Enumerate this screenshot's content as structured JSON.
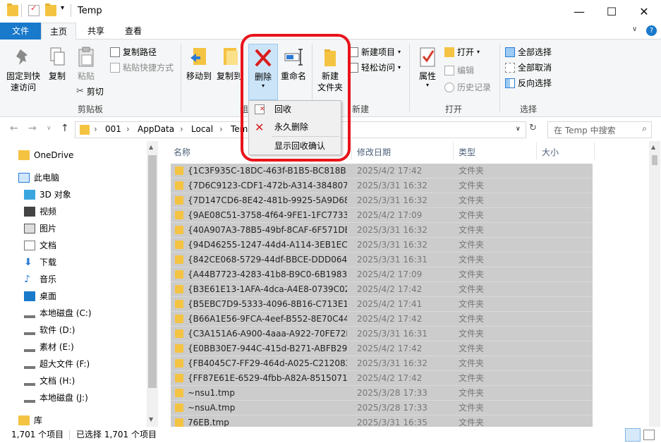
{
  "window": {
    "title": "Temp",
    "minimize_glyph": "—",
    "maximize_glyph": "☐",
    "close_glyph": "✕"
  },
  "tabs": {
    "file": "文件",
    "home": "主页",
    "share": "共享",
    "view": "查看"
  },
  "ribbon": {
    "pin": "固定到快\n速访问",
    "pin_l1": "固定到快",
    "pin_l2": "速访问",
    "copy": "复制",
    "paste": "粘贴",
    "copy_path": "复制路径",
    "paste_shortcut": "粘贴快捷方式",
    "cut": "剪切",
    "group_clipboard": "剪贴板",
    "move_to": "移动到",
    "copy_to": "复制到",
    "delete": "删除",
    "rename": "重命名",
    "group_organize": "组织",
    "new_folder_l1": "新建",
    "new_folder_l2": "文件夹",
    "new_item": "新建项目",
    "easy_access": "轻松访问",
    "group_new": "新建",
    "properties": "属性",
    "open": "打开",
    "edit": "编辑",
    "history": "历史记录",
    "group_open": "打开",
    "select_all": "全部选择",
    "select_none": "全部取消",
    "invert_selection": "反向选择",
    "group_select": "选择"
  },
  "delete_menu": {
    "recycle": "回收",
    "permanent": "永久删除",
    "show_confirm": "显示回收确认"
  },
  "address": {
    "crumbs": [
      "001",
      "AppData",
      "Local",
      "Temp"
    ],
    "search_placeholder": "在 Temp 中搜索"
  },
  "nav": {
    "onedrive": "OneDrive",
    "this_pc": "此电脑",
    "items": [
      "3D 对象",
      "视频",
      "图片",
      "文档",
      "下载",
      "音乐",
      "桌面",
      "本地磁盘 (C:)",
      "软件 (D:)",
      "素材 (E:)",
      "超大文件 (F:)",
      "文档 (H:)",
      "本地磁盘 (J:)"
    ],
    "library": "库"
  },
  "columns": {
    "name": "名称",
    "date": "修改日期",
    "type": "类型",
    "size": "大小"
  },
  "files": [
    {
      "name": "{1C3F935C-18DC-463f-B1B5-BC818B...",
      "date": "2025/4/2 17:42",
      "type": "文件夹"
    },
    {
      "name": "{7D6C9123-CDF1-472b-A314-384807...",
      "date": "2025/3/31 16:32",
      "type": "文件夹"
    },
    {
      "name": "{7D147CD6-8E42-481b-9925-5A9D68...",
      "date": "2025/3/31 16:32",
      "type": "文件夹"
    },
    {
      "name": "{9AE08C51-3758-4f64-9FE1-1FC7733...",
      "date": "2025/4/2 17:09",
      "type": "文件夹"
    },
    {
      "name": "{40A907A3-78B5-49bf-8CAF-6F571DB...",
      "date": "2025/3/31 16:32",
      "type": "文件夹"
    },
    {
      "name": "{94D46255-1247-44d4-A114-3EB1EC...",
      "date": "2025/3/31 16:32",
      "type": "文件夹"
    },
    {
      "name": "{842CE068-5729-44df-BBCE-DDD064...",
      "date": "2025/3/31 16:31",
      "type": "文件夹"
    },
    {
      "name": "{A44B7723-4283-41b8-B9C0-6B1983...",
      "date": "2025/4/2 17:09",
      "type": "文件夹"
    },
    {
      "name": "{B3E61E13-1AFA-4dca-A4E8-0739C02...",
      "date": "2025/4/2 17:42",
      "type": "文件夹"
    },
    {
      "name": "{B5EBC7D9-5333-4096-8B16-C713E1...",
      "date": "2025/4/2 17:41",
      "type": "文件夹"
    },
    {
      "name": "{B66A1E56-9FCA-4eef-B552-8E70C44...",
      "date": "2025/4/2 17:42",
      "type": "文件夹"
    },
    {
      "name": "{C3A151A6-A900-4aaa-A922-70FE72F...",
      "date": "2025/3/31 16:31",
      "type": "文件夹"
    },
    {
      "name": "{E0BB30E7-944C-415d-B271-ABFB29...",
      "date": "2025/4/2 17:42",
      "type": "文件夹"
    },
    {
      "name": "{FB4045C7-FF29-464d-A025-C212083...",
      "date": "2025/3/31 16:32",
      "type": "文件夹"
    },
    {
      "name": "{FF87E61E-6529-4fbb-A82A-8515071...",
      "date": "2025/4/2 17:42",
      "type": "文件夹"
    },
    {
      "name": "~nsu1.tmp",
      "date": "2025/3/28 17:33",
      "type": "文件夹"
    },
    {
      "name": "~nsuA.tmp",
      "date": "2025/3/28 17:33",
      "type": "文件夹"
    },
    {
      "name": "76EB.tmp",
      "date": "2025/3/31 16:35",
      "type": "文件夹"
    }
  ],
  "status": {
    "count": "1,701 个项目",
    "selected": "已选择 1,701 个项目"
  },
  "colors": {
    "accent": "#1979ca",
    "highlight_ring": "#e8131a",
    "selected_row": "#cccccc",
    "folder": "#f5c342",
    "delete_red": "#d91c1c"
  }
}
